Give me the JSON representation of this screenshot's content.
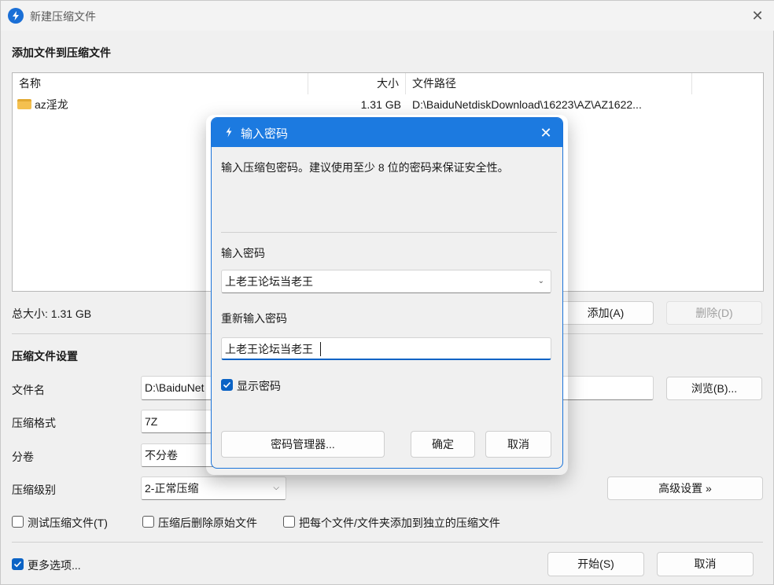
{
  "window": {
    "title": "新建压缩文件",
    "close_glyph": "✕"
  },
  "add_section": {
    "title": "添加文件到压缩文件",
    "columns": [
      "名称",
      "大小",
      "文件路径"
    ],
    "rows": [
      {
        "name": "az淫龙",
        "size": "1.31 GB",
        "path": "D:\\BaiduNetdiskDownload\\16223\\AZ\\AZ1622..."
      }
    ],
    "total_size": "总大小: 1.31 GB",
    "add_button": "添加(A)",
    "delete_button": "删除(D)"
  },
  "settings": {
    "title": "压缩文件设置",
    "filename_label": "文件名",
    "filename_value": "D:\\BaiduNet",
    "browse_button": "浏览(B)...",
    "format_label": "压缩格式",
    "format_value": "7Z",
    "split_label": "分卷",
    "split_value": "不分卷",
    "level_label": "压缩级别",
    "level_value": "2-正常压缩",
    "advanced_button": "高级设置 »",
    "opt_test": "测试压缩文件(T)",
    "opt_delete": "压缩后删除原始文件",
    "opt_each": "把每个文件/文件夹添加到独立的压缩文件",
    "more_options": "更多选项...",
    "start_button": "开始(S)",
    "cancel_button": "取消"
  },
  "dialog": {
    "title": "输入密码",
    "close_glyph": "✕",
    "hint": "输入压缩包密码。建议使用至少 8 位的密码来保证安全性。",
    "password_label": "输入密码",
    "password_value": "上老王论坛当老王",
    "reenter_label": "重新输入密码",
    "reenter_value": "上老王论坛当老王",
    "show_password": "显示密码",
    "manager_button": "密码管理器...",
    "ok_button": "确定",
    "cancel_button": "取消"
  },
  "colors": {
    "accent": "#1c7ae0",
    "checkbox": "#0b63c5",
    "folder": "#f4c04f"
  }
}
